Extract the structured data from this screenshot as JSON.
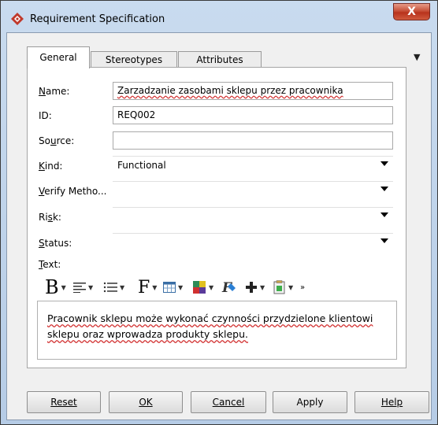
{
  "window": {
    "title": "Requirement Specification",
    "close_label": "X",
    "overflow_indicator": "▼"
  },
  "tabs": [
    {
      "label": "General",
      "active": true
    },
    {
      "label": "Stereotypes",
      "active": false
    },
    {
      "label": "Attributes",
      "active": false
    }
  ],
  "form": {
    "name": {
      "label": "Name:",
      "mnemonic": "N",
      "value": "Zarzadzanie zasobami sklepu przez pracownika"
    },
    "id": {
      "label": "ID:",
      "value": "REQ002"
    },
    "source": {
      "label": "Source:",
      "mnemonic": "u",
      "value": ""
    },
    "kind": {
      "label": "Kind:",
      "mnemonic": "K",
      "value": "Functional"
    },
    "verify_method": {
      "label": "Verify Metho...",
      "mnemonic": "V",
      "value": ""
    },
    "risk": {
      "label": "Risk:",
      "mnemonic": "s",
      "value": ""
    },
    "status": {
      "label": "Status:",
      "mnemonic": "S",
      "value": ""
    },
    "text": {
      "label": "Text:",
      "mnemonic": "T",
      "value": "Pracownik sklepu może wykonać czynności przydzielone klientowi sklepu oraz wprowadza produkty sklepu."
    }
  },
  "toolbar": {
    "bold_glyph": "B",
    "font_glyph": "F",
    "more_glyph": "»",
    "icons": [
      "bold-icon",
      "align-icon",
      "list-icon",
      "font-icon",
      "table-icon",
      "color-icon",
      "format-icon",
      "add-icon",
      "insert-icon"
    ]
  },
  "buttons": {
    "reset": "Reset",
    "ok": "OK",
    "cancel": "Cancel",
    "apply": "Apply",
    "help": "Help"
  },
  "colors": {
    "titlebar": "#c9dbef",
    "close": "#c75038",
    "app_icon": "#c0392b",
    "spellcheck": "#d23030"
  }
}
